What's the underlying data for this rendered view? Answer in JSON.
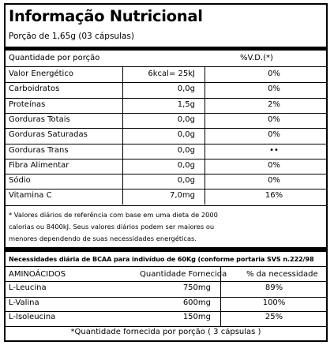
{
  "title": "Informação Nutricional",
  "serving": "Porção de 1,65g (03 cápsulas)",
  "headers": {
    "quantity": "Quantidade por porção",
    "daily_value": "%V.D.(*)"
  },
  "nutrients": [
    {
      "label": "Valor Energético",
      "amount": "6kcal= 25kJ",
      "dv": "0%"
    },
    {
      "label": "Carboidratos",
      "amount": "0,0g",
      "dv": "0%"
    },
    {
      "label": "Proteínas",
      "amount": "1,5g",
      "dv": "2%"
    },
    {
      "label": "Gorduras Totais",
      "amount": "0,0g",
      "dv": "0%"
    },
    {
      "label": "Gorduras Saturadas",
      "amount": "0,0g",
      "dv": "0%"
    },
    {
      "label": "Gorduras Trans",
      "amount": "0,0g",
      "dv": "••"
    },
    {
      "label": "Fibra Alimentar",
      "amount": "0,0g",
      "dv": "0%"
    },
    {
      "label": "Sódio",
      "amount": "0,0g",
      "dv": "0%"
    },
    {
      "label": "Vitamina C",
      "amount": "7,0mg",
      "dv": "16%"
    }
  ],
  "footnote": "* Valores diários de referência com base em uma dieta de 2000\ncalorias ou 8400kJ. Seus valores diários podem ser maiores ou\nmenores dependendo de suas necessidades energéticas.",
  "bcaa": {
    "title": "Necessidades diária de BCAA para indivíduo de 60Kg (conforme portaria SVS n.222/98",
    "headers": {
      "name": "AMINOÁCIDOS",
      "quantity": "Quantidade Fornecida",
      "percent": "% da necessidade"
    },
    "rows": [
      {
        "name": "L-Leucina",
        "quantity": "750mg",
        "percent": "89%"
      },
      {
        "name": "L-Valina",
        "quantity": "600mg",
        "percent": "100%"
      },
      {
        "name": "L-Isoleucina",
        "quantity": "150mg",
        "percent": "25%"
      }
    ],
    "footnote": "*Quantidade fornecida por porção ( 3 cápsulas )"
  }
}
